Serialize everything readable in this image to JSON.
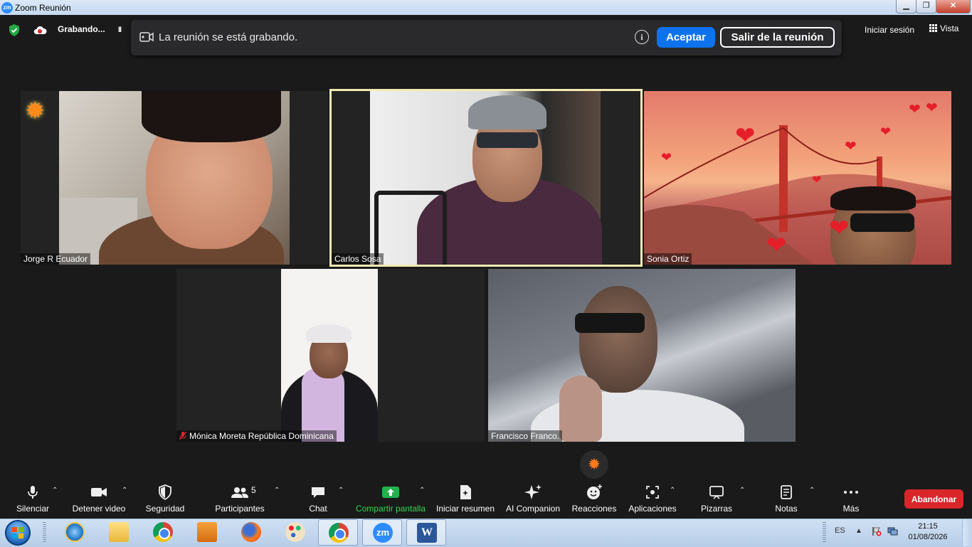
{
  "window": {
    "app_icon": "zm",
    "title": "Zoom Reunión",
    "min_icon": "minimize-icon",
    "max_icon": "restore-icon",
    "close_icon": "close-icon"
  },
  "topbar": {
    "recording_label": "Grabando...",
    "pause_symbol": "II",
    "signin": "Iniciar sesión",
    "view": "Vista"
  },
  "banner": {
    "message": "La reunión se está grabando.",
    "info_symbol": "i",
    "accept_label": "Aceptar",
    "leave_label": "Salir de la reunión"
  },
  "participants": [
    {
      "name": "Jorge R Ecuador",
      "reaction": "✹"
    },
    {
      "name": "Carlos Sosa",
      "active_speaker": true
    },
    {
      "name": "Sonia Ortiz",
      "reaction": "hearts"
    },
    {
      "name": "Mónica Moreta República Dominicana",
      "muted": true
    },
    {
      "name": "Francisco Franco."
    }
  ],
  "floating_reaction": "✹",
  "toolbar": {
    "mute": "Silenciar",
    "video": "Detener video",
    "security": "Seguridad",
    "participants": "Participantes",
    "participants_count": "5",
    "chat": "Chat",
    "share": "Compartir pantalla",
    "summary": "Iniciar resumen",
    "ai": "AI Companion",
    "reactions": "Reacciones",
    "apps": "Aplicaciones",
    "whiteboards": "Pizarras",
    "notes": "Notas",
    "more": "Más",
    "end": "Abandonar"
  },
  "taskbar": {
    "apps": [
      "internet-explorer",
      "file-explorer",
      "chrome",
      "media-player",
      "firefox",
      "paint",
      "chrome",
      "zoom",
      "word"
    ],
    "zoom_label": "zm",
    "word_label": "W",
    "language": "ES",
    "time": "21:15",
    "date": "01/08/2026"
  },
  "colors": {
    "accent": "#0e72ed",
    "end": "#d9262b",
    "share_green": "#39d353",
    "active_border": "#f2eab2"
  }
}
